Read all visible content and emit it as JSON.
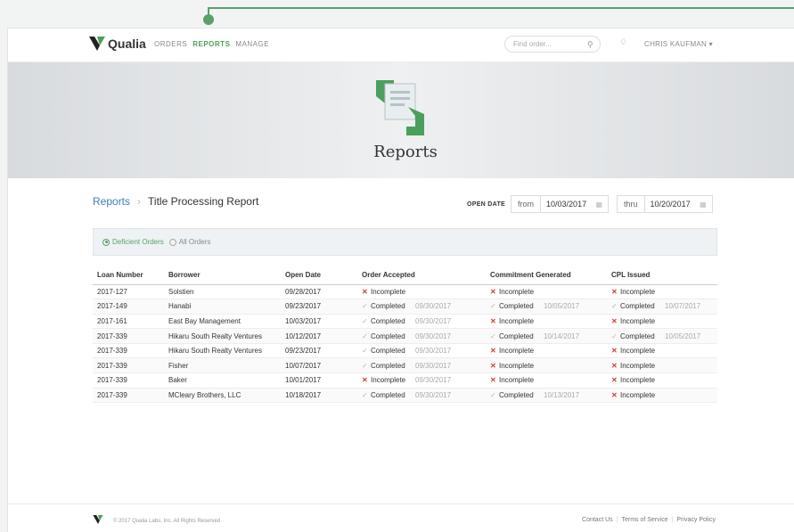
{
  "app": {
    "name": "Qualia"
  },
  "nav": {
    "orders": "ORDERS",
    "reports": "REPORTS",
    "manage": "MANAGE"
  },
  "search": {
    "placeholder": "Find order..."
  },
  "user": {
    "name": "CHRIS KAUFMAN ▾"
  },
  "banner": {
    "title": "Reports"
  },
  "breadcrumb": {
    "root": "Reports",
    "current": "Title Processing Report"
  },
  "date_filter": {
    "label": "OPEN DATE",
    "from_label": "from",
    "from_value": "10/03/2017",
    "thru_label": "thru",
    "thru_value": "10/20/2017"
  },
  "filters": {
    "deficient": "Deficient Orders",
    "all": "All Orders"
  },
  "table": {
    "headers": [
      "Loan Number",
      "Borrower",
      "Open Date",
      "Order Accepted",
      "Commitment Generated",
      "CPL Issued"
    ],
    "rows": [
      {
        "loan": "2017-127",
        "borrower": "Solstien",
        "open": "09/28/2017",
        "oa": "Incomplete",
        "oa_ok": false,
        "oa_date": "",
        "cg": "Incomplete",
        "cg_ok": false,
        "cg_date": "",
        "cpl": "Incomplete",
        "cpl_ok": false,
        "cpl_date": ""
      },
      {
        "loan": "2017-149",
        "borrower": "Hanabi",
        "open": "09/23/2017",
        "oa": "Completed",
        "oa_ok": true,
        "oa_date": "09/30/2017",
        "cg": "Completed",
        "cg_ok": true,
        "cg_date": "10/05/2017",
        "cpl": "Completed",
        "cpl_ok": true,
        "cpl_date": "10/07/2017"
      },
      {
        "loan": "2017-161",
        "borrower": "East Bay Management",
        "open": "10/03/2017",
        "oa": "Completed",
        "oa_ok": true,
        "oa_date": "09/30/2017",
        "cg": "Incomplete",
        "cg_ok": false,
        "cg_date": "",
        "cpl": "Incomplete",
        "cpl_ok": false,
        "cpl_date": ""
      },
      {
        "loan": "2017-339",
        "borrower": "Hikaru South Realty Ventures",
        "open": "10/12/2017",
        "oa": "Completed",
        "oa_ok": true,
        "oa_date": "09/30/2017",
        "cg": "Completed",
        "cg_ok": true,
        "cg_date": "10/14/2017",
        "cpl": "Completed",
        "cpl_ok": true,
        "cpl_date": "10/05/2017"
      },
      {
        "loan": "2017-339",
        "borrower": "Hikaru South Realty Ventures",
        "open": "09/23/2017",
        "oa": "Completed",
        "oa_ok": true,
        "oa_date": "09/30/2017",
        "cg": "Incomplete",
        "cg_ok": false,
        "cg_date": "",
        "cpl": "Incomplete",
        "cpl_ok": false,
        "cpl_date": ""
      },
      {
        "loan": "2017-339",
        "borrower": "Fisher",
        "open": "10/07/2017",
        "oa": "Completed",
        "oa_ok": true,
        "oa_date": "09/30/2017",
        "cg": "Incomplete",
        "cg_ok": false,
        "cg_date": "",
        "cpl": "Incomplete",
        "cpl_ok": false,
        "cpl_date": ""
      },
      {
        "loan": "2017-339",
        "borrower": "Baker",
        "open": "10/01/2017",
        "oa": "Incomplete",
        "oa_ok": false,
        "oa_date": "09/30/2017",
        "cg": "Incomplete",
        "cg_ok": false,
        "cg_date": "",
        "cpl": "Incomplete",
        "cpl_ok": false,
        "cpl_date": ""
      },
      {
        "loan": "2017-339",
        "borrower": "MCleary Brothers, LLC",
        "open": "10/18/2017",
        "oa": "Completed",
        "oa_ok": true,
        "oa_date": "09/30/2017",
        "cg": "Completed",
        "cg_ok": true,
        "cg_date": "10/13/2017",
        "cpl": "Incomplete",
        "cpl_ok": false,
        "cpl_date": ""
      }
    ]
  },
  "footer": {
    "copyright": "© 2017 Qualia Labs, Inc. All Rights Reserved",
    "contact": "Contact Us",
    "terms": "Terms of Service",
    "privacy": "Privacy Policy"
  },
  "colors": {
    "brand_green": "#5aa06a",
    "link_blue": "#3f7cc0",
    "error_red": "#d23b3b",
    "banner_bg": "#e2e5e7"
  },
  "icons": {
    "logo": "qualia-v-logo",
    "search": "search-icon",
    "bell": "bell-icon",
    "calendar": "calendar-icon",
    "check": "check-icon",
    "cross": "x-icon"
  }
}
